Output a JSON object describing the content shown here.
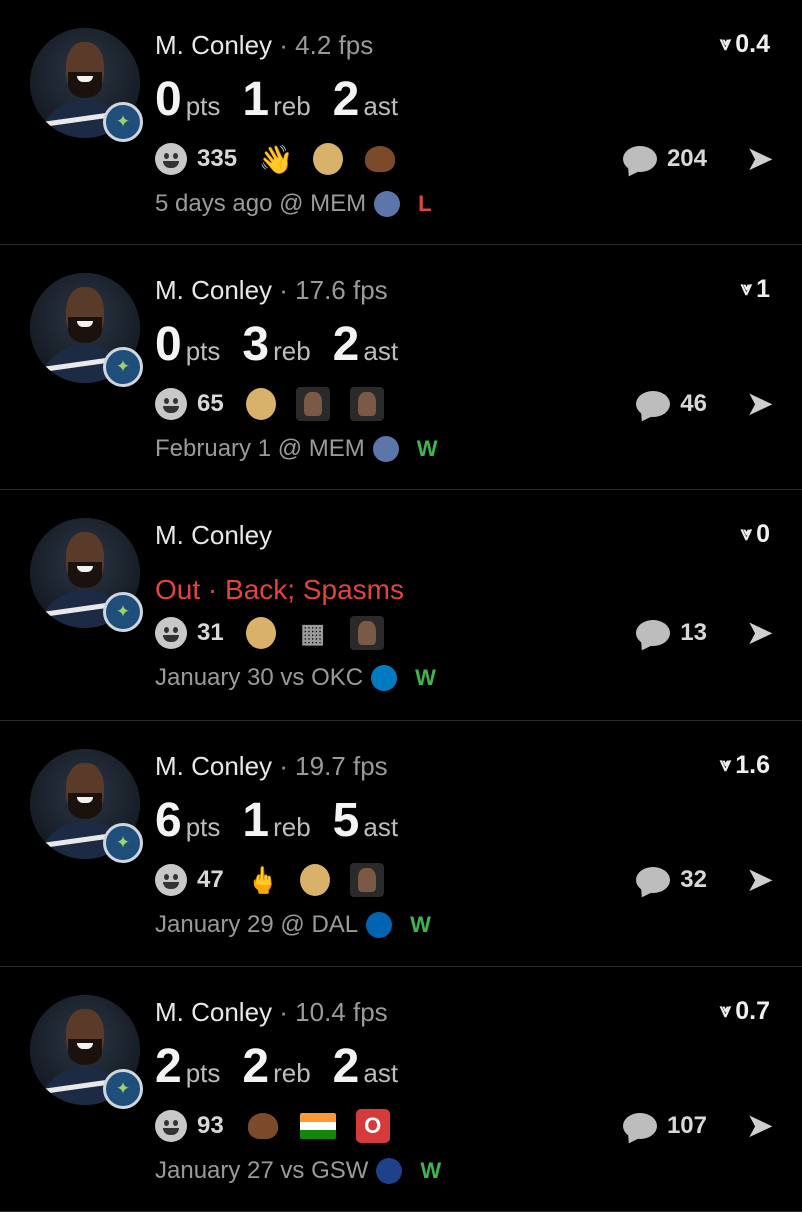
{
  "feed": [
    {
      "player": "M. Conley",
      "sep": " · ",
      "fps": "4.2 fps",
      "status": null,
      "stats": [
        {
          "value": "0",
          "unit": "pts"
        },
        {
          "value": "1",
          "unit": "reb"
        },
        {
          "value": "2",
          "unit": "ast"
        }
      ],
      "score": "0.4",
      "reaction_count": "335",
      "reactions": [
        "waving-hand-emoji",
        "baby-emoji",
        "poop-emoji"
      ],
      "comment_count": "204",
      "meta": "5 days ago @ MEM",
      "opponent_logo": "grizzlies-logo",
      "result": "L"
    },
    {
      "player": "M. Conley",
      "sep": " · ",
      "fps": "17.6 fps",
      "status": null,
      "stats": [
        {
          "value": "0",
          "unit": "pts"
        },
        {
          "value": "3",
          "unit": "reb"
        },
        {
          "value": "2",
          "unit": "ast"
        }
      ],
      "score": "1",
      "reaction_count": "65",
      "reactions": [
        "baby-emoji",
        "reaction-photo",
        "reaction-photo"
      ],
      "comment_count": "46",
      "meta": "February 1 @ MEM",
      "opponent_logo": "grizzlies-logo",
      "result": "W"
    },
    {
      "player": "M. Conley",
      "sep": "",
      "fps": "",
      "status": "Out · Back; Spasms",
      "stats": [],
      "score": "0",
      "reaction_count": "31",
      "reactions": [
        "baby-emoji",
        "basketball-hoop-emoji",
        "reaction-photo"
      ],
      "comment_count": "13",
      "meta": "January 30 vs OKC",
      "opponent_logo": "thunder-logo",
      "result": "W"
    },
    {
      "player": "M. Conley",
      "sep": " · ",
      "fps": "19.7 fps",
      "status": null,
      "stats": [
        {
          "value": "6",
          "unit": "pts"
        },
        {
          "value": "1",
          "unit": "reb"
        },
        {
          "value": "5",
          "unit": "ast"
        }
      ],
      "score": "1.6",
      "reaction_count": "47",
      "reactions": [
        "middle-finger-emoji",
        "baby-emoji",
        "reaction-photo"
      ],
      "comment_count": "32",
      "meta": "January 29 @ DAL",
      "opponent_logo": "mavericks-logo",
      "result": "W"
    },
    {
      "player": "M. Conley",
      "sep": " · ",
      "fps": "10.4 fps",
      "status": null,
      "stats": [
        {
          "value": "2",
          "unit": "pts"
        },
        {
          "value": "2",
          "unit": "reb"
        },
        {
          "value": "2",
          "unit": "ast"
        }
      ],
      "score": "0.7",
      "reaction_count": "93",
      "reactions": [
        "poop-emoji",
        "india-flag-emoji",
        "o-button-emoji"
      ],
      "comment_count": "107",
      "meta": "January 27 vs GSW",
      "opponent_logo": "warriors-logo",
      "result": "W"
    }
  ],
  "colors": {
    "background": "#000000",
    "loss": "#e0453e",
    "win": "#3fb44f",
    "out_status": "#e0453e",
    "team_badge": "#1f4e7a"
  },
  "glyphs": {
    "share": "➤",
    "score_icon": "⩔",
    "team_badge": "✦",
    "o_button": "O",
    "wave": "👋",
    "finger": "🖕",
    "hoop": "▦"
  }
}
